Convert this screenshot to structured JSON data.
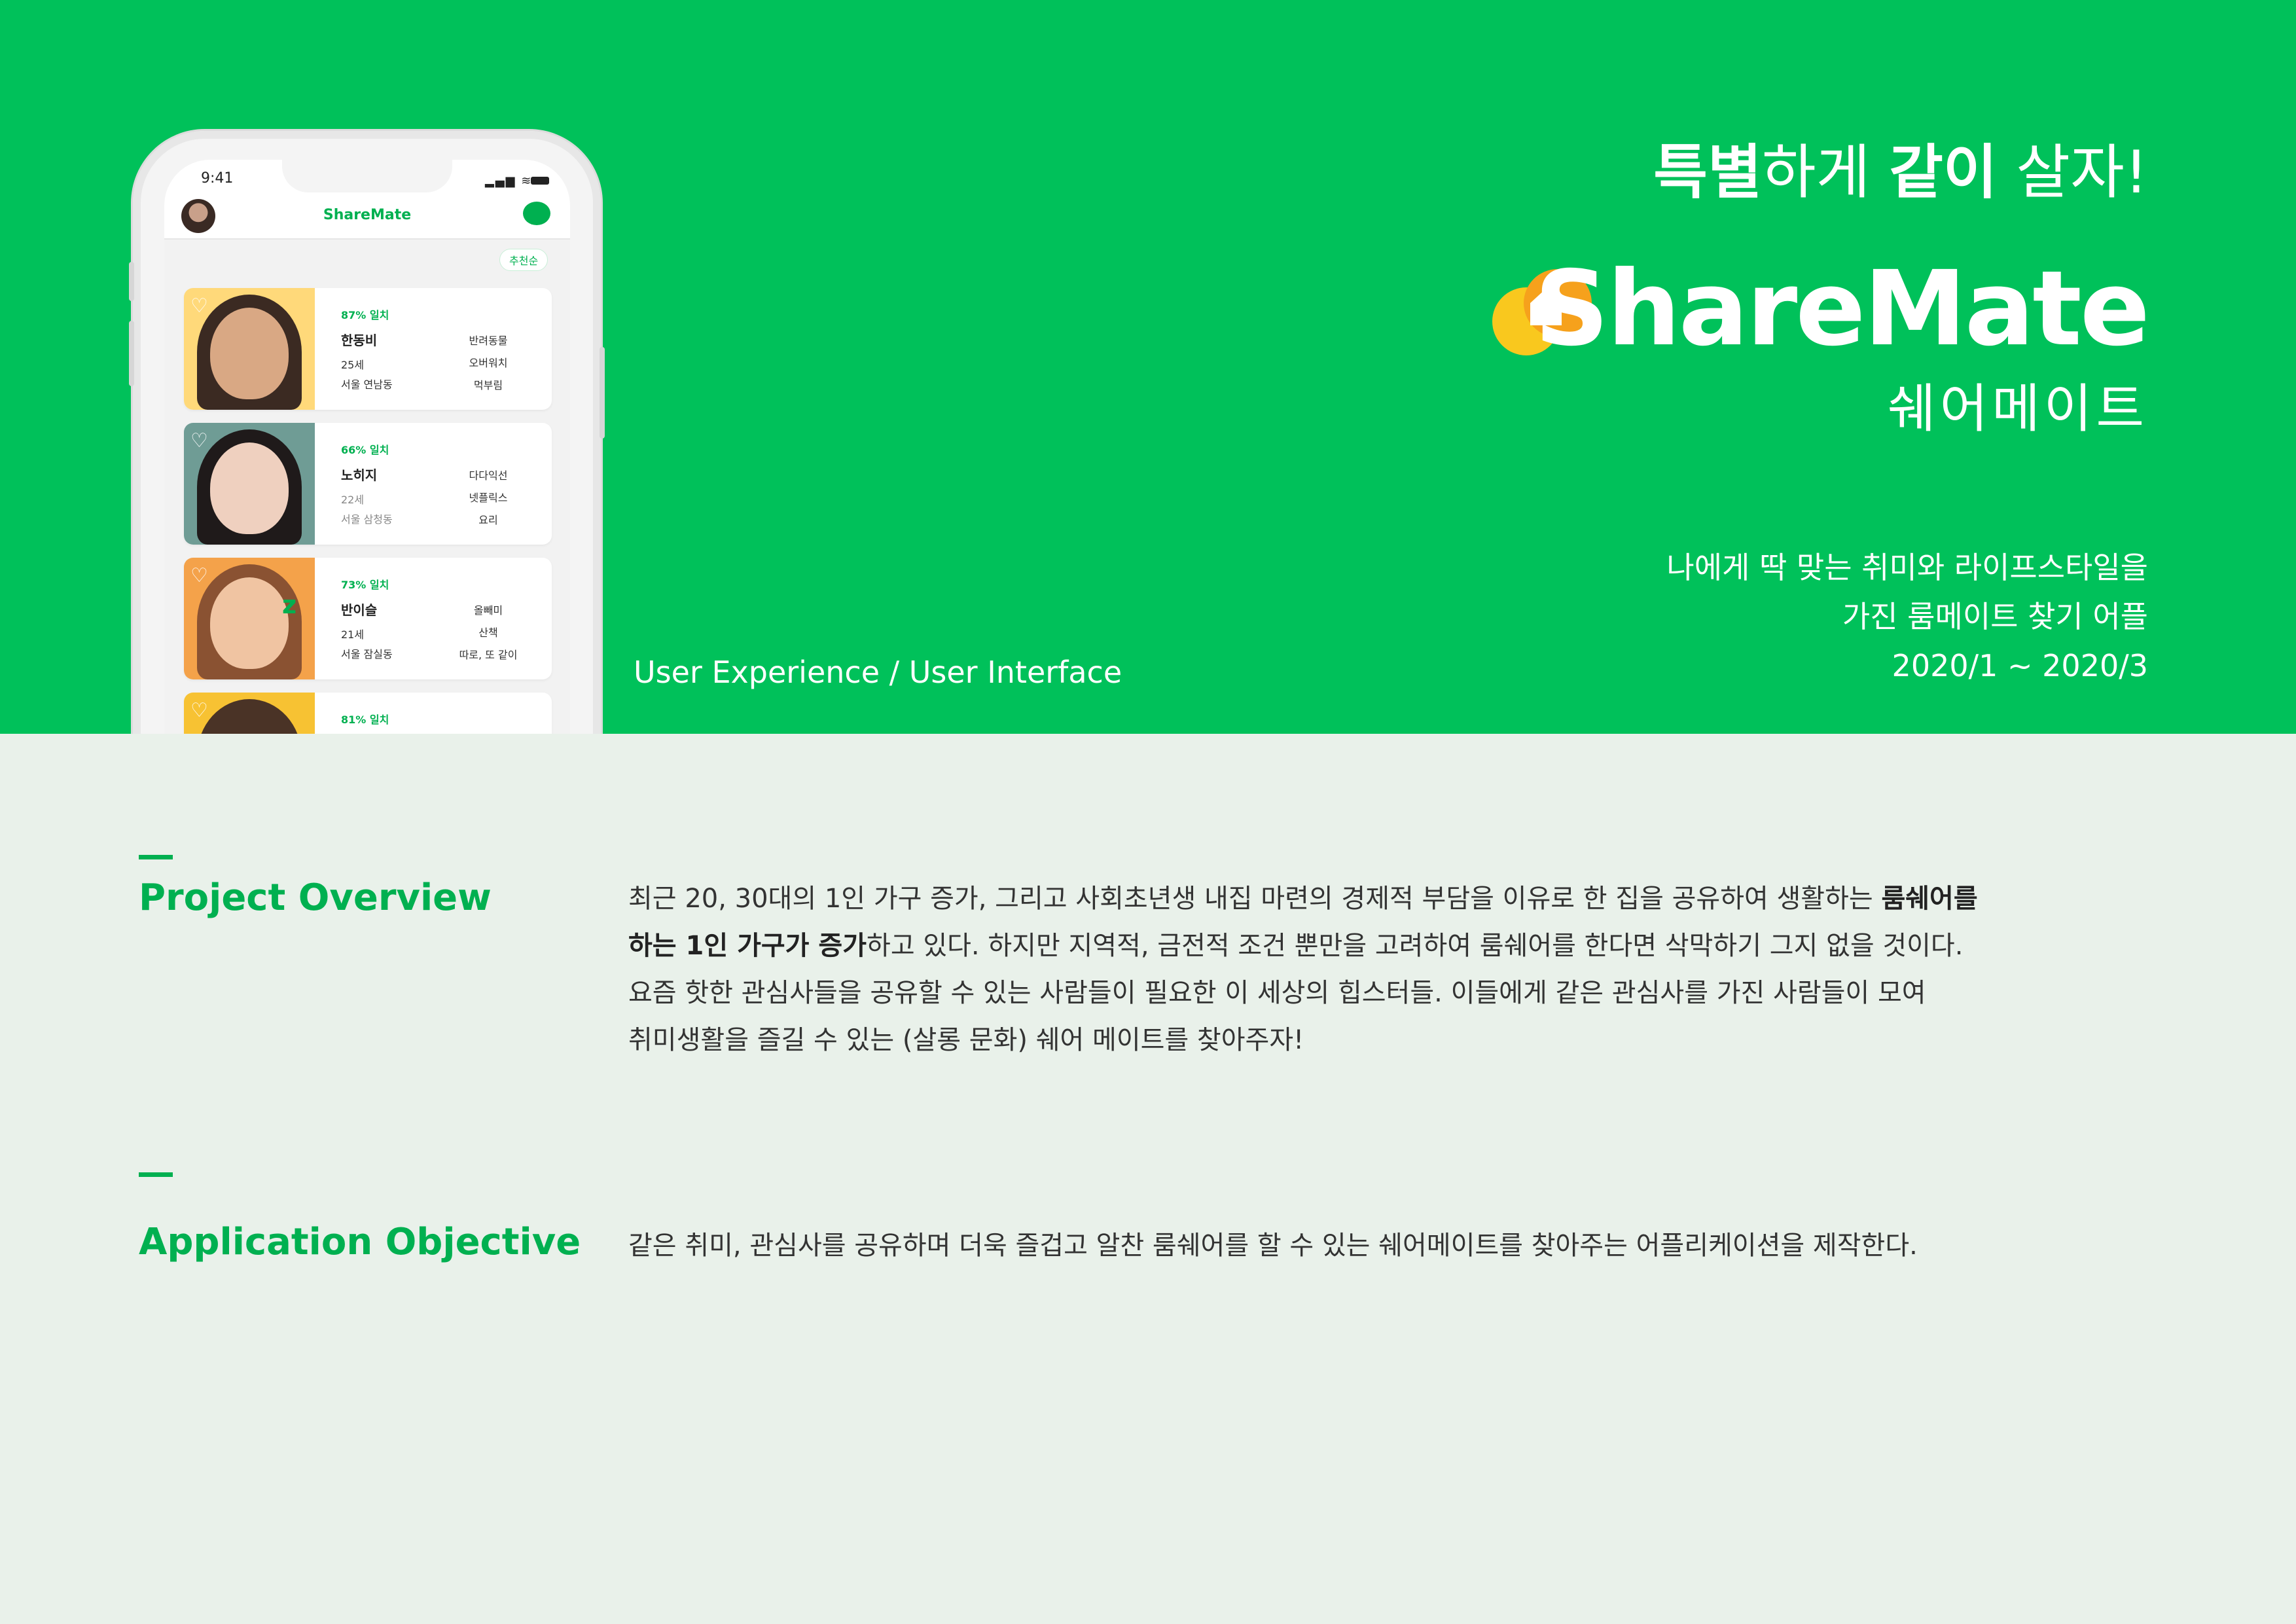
{
  "phone": {
    "time": "9:41",
    "app_name": "ShareMate",
    "sort_chip": "추천순",
    "cards": [
      {
        "match": "87% 일치",
        "name": "한동비",
        "age": "25세",
        "location": "서울 연남동",
        "tags": [
          "반려동물",
          "오버워치",
          "먹부림"
        ]
      },
      {
        "match": "66% 일치",
        "name": "노히지",
        "age": "22세",
        "location": "서울 삼청동",
        "tags": [
          "다다익선",
          "넷플릭스",
          "요리"
        ]
      },
      {
        "match": "73% 일치",
        "name": "반이슬",
        "age": "21세",
        "location": "서울 잠실동",
        "tags": [
          "올빼미",
          "산책",
          "따로, 또 같이"
        ]
      },
      {
        "match": "81% 일치"
      }
    ]
  },
  "hero": {
    "slogan_bold1": "특별",
    "slogan_mid": "하게 ",
    "slogan_bold2": "같이",
    "slogan_end": " 살자!",
    "logo_text": "ShareMate",
    "logo_kr": "쉐어메이트",
    "desc_line1": "나에게 딱 맞는 취미와 라이프스타일을",
    "desc_line2": "가진 룸메이트 찾기 어플",
    "period": "2020/1 ~ 2020/3",
    "ux_label": "User Experience / User Interface",
    "colors": {
      "brand": "#00c15a",
      "logo_yellow": "#f9c81e",
      "logo_orange": "#f6a11c"
    }
  },
  "overview": {
    "title": "Project Overview",
    "line1_a": "최근 20, 30대의 1인 가구 증가, 그리고 사회초년생 내집 마련의 경제적 부담을 이유로 한 집을 공유하여 생활하는 ",
    "line1_b": "룸쉐어를",
    "line2_a": "하는 1인 가구가 증가",
    "line2_b": "하고 있다. 하지만 지역적, 금전적 조건 뿐만을 고려하여 룸쉐어를 한다면 삭막하기 그지 없을 것이다.",
    "line3": "요즘 핫한 관심사들을 공유할 수 있는 사람들이 필요한 이 세상의 힙스터들. 이들에게 같은 관심사를 가진 사람들이 모여",
    "line4": "취미생활을 즐길 수 있는 (살롱 문화) 쉐어 메이트를 찾아주자!"
  },
  "objective": {
    "title": "Application Objective",
    "body": "같은 취미, 관심사를 공유하며 더욱 즐겁고 알찬 룸쉐어를 할 수 있는 쉐어메이트를 찾아주는 어플리케이션을 제작한다."
  }
}
